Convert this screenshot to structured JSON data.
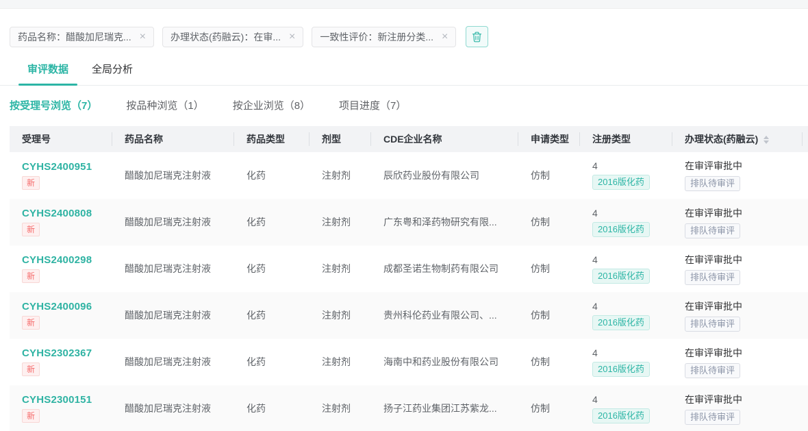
{
  "accent_color": "#2cb5a5",
  "filters": {
    "tags": [
      {
        "label": "药品名称：醋酸加尼瑞克...",
        "close": "×"
      },
      {
        "label": "办理状态(药融云)：在审...",
        "close": "×"
      },
      {
        "label": "一致性评价：新注册分类...",
        "close": "×"
      }
    ]
  },
  "tabs": [
    {
      "label": "审评数据"
    },
    {
      "label": "全局分析"
    }
  ],
  "subtabs": [
    {
      "label": "按受理号浏览（7）"
    },
    {
      "label": "按品种浏览（1）"
    },
    {
      "label": "按企业浏览（8）"
    },
    {
      "label": "项目进度（7）"
    }
  ],
  "table": {
    "columns": {
      "acceptance_no": "受理号",
      "drug_name": "药品名称",
      "drug_type": "药品类型",
      "dosage_form": "剂型",
      "company": "CDE企业名称",
      "application_type": "申请类型",
      "registration_type": "注册类型",
      "status": "办理状态(药融云)"
    },
    "rows": [
      {
        "acceptance_no": "CYHS2400951",
        "new_badge": "新",
        "drug_name": "醋酸加尼瑞克注射液",
        "drug_type": "化药",
        "dosage_form": "注射剂",
        "company": "辰欣药业股份有限公司",
        "application_type": "仿制",
        "registration_type": "4",
        "registration_badge": "2016版化药",
        "status": "在审评审批中",
        "status_badge": "排队待审评"
      },
      {
        "acceptance_no": "CYHS2400808",
        "new_badge": "新",
        "drug_name": "醋酸加尼瑞克注射液",
        "drug_type": "化药",
        "dosage_form": "注射剂",
        "company": "广东粤和泽药物研究有限...",
        "application_type": "仿制",
        "registration_type": "4",
        "registration_badge": "2016版化药",
        "status": "在审评审批中",
        "status_badge": "排队待审评"
      },
      {
        "acceptance_no": "CYHS2400298",
        "new_badge": "新",
        "drug_name": "醋酸加尼瑞克注射液",
        "drug_type": "化药",
        "dosage_form": "注射剂",
        "company": "成都圣诺生物制药有限公司",
        "application_type": "仿制",
        "registration_type": "4",
        "registration_badge": "2016版化药",
        "status": "在审评审批中",
        "status_badge": "排队待审评"
      },
      {
        "acceptance_no": "CYHS2400096",
        "new_badge": "新",
        "drug_name": "醋酸加尼瑞克注射液",
        "drug_type": "化药",
        "dosage_form": "注射剂",
        "company": "贵州科伦药业有限公司、...",
        "application_type": "仿制",
        "registration_type": "4",
        "registration_badge": "2016版化药",
        "status": "在审评审批中",
        "status_badge": "排队待审评"
      },
      {
        "acceptance_no": "CYHS2302367",
        "new_badge": "新",
        "drug_name": "醋酸加尼瑞克注射液",
        "drug_type": "化药",
        "dosage_form": "注射剂",
        "company": "海南中和药业股份有限公司",
        "application_type": "仿制",
        "registration_type": "4",
        "registration_badge": "2016版化药",
        "status": "在审评审批中",
        "status_badge": "排队待审评"
      },
      {
        "acceptance_no": "CYHS2300151",
        "new_badge": "新",
        "drug_name": "醋酸加尼瑞克注射液",
        "drug_type": "化药",
        "dosage_form": "注射剂",
        "company": "扬子江药业集团江苏紫龙...",
        "application_type": "仿制",
        "registration_type": "4",
        "registration_badge": "2016版化药",
        "status": "在审评审批中",
        "status_badge": "排队待审评"
      }
    ]
  }
}
